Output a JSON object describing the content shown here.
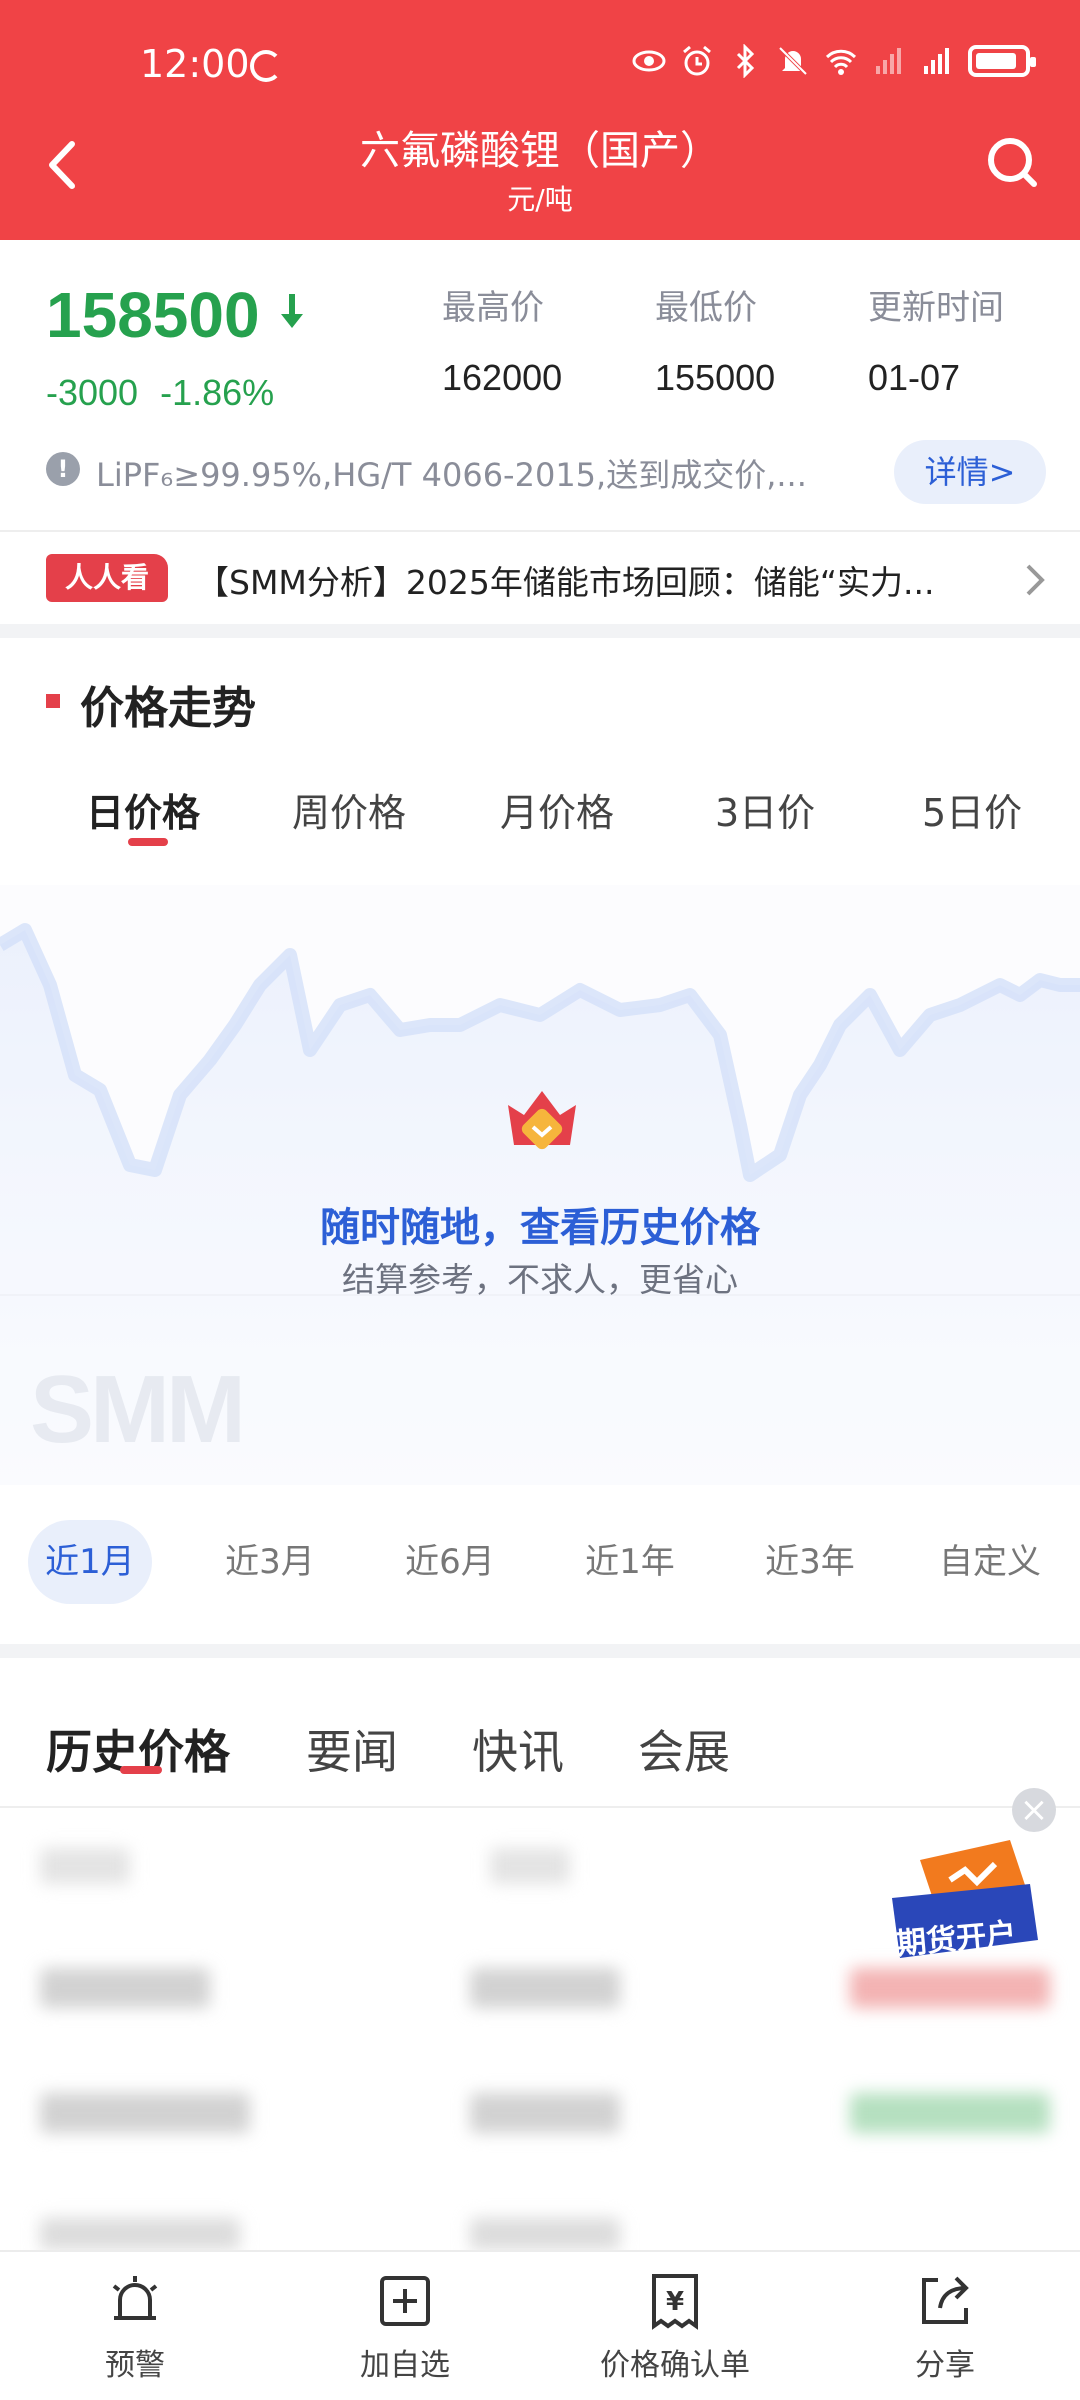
{
  "status_bar": {
    "time": "12:00",
    "icons": [
      "eye-icon",
      "alarm-icon",
      "bluetooth-icon",
      "mute-icon",
      "wifi-icon",
      "signal-icon",
      "signal-5g-icon",
      "battery-icon"
    ]
  },
  "header": {
    "title": "六氟磷酸锂（国产）",
    "subtitle": "元/吨",
    "back_icon": "back-arrow-icon",
    "search_icon": "search-icon"
  },
  "price": {
    "current": "158500",
    "direction": "down",
    "change_abs": "-3000",
    "change_pct": "-1.86%",
    "high_label": "最高价",
    "high_value": "162000",
    "low_label": "最低价",
    "low_value": "155000",
    "update_label": "更新时间",
    "update_value": "01-07",
    "description": "LiPF₆≥99.95%,HG/T 4066-2015,送到成交价,...",
    "detail_label": "详情>",
    "colors": {
      "down": "#26a14e",
      "accent": "#f04346",
      "link": "#2c5fd6"
    }
  },
  "news": {
    "tag": "人人看",
    "headline": "【SMM分析】2025年储能市场回顾：储能“实力..."
  },
  "trend": {
    "section_title": "价格走势",
    "period_tabs": [
      "日价格",
      "周价格",
      "月价格",
      "3日价",
      "5日价"
    ],
    "active_period": 0,
    "promo_title": "随时随地，查看历史价格",
    "promo_subtitle": "结算参考，不求人，更省心",
    "watermark": "SMM",
    "range_tabs": [
      "近1月",
      "近3月",
      "近6月",
      "近1年",
      "近3年",
      "自定义"
    ],
    "active_range": 0
  },
  "content_tabs": {
    "tabs": [
      "历史价格",
      "要闻",
      "快讯",
      "会展"
    ],
    "active": 0
  },
  "float_ad": {
    "label": "期货开户"
  },
  "bottom_nav": {
    "items": [
      {
        "label": "预警",
        "icon": "alarm-bell-icon"
      },
      {
        "label": "加自选",
        "icon": "add-watchlist-icon"
      },
      {
        "label": "价格确认单",
        "icon": "price-confirm-icon"
      },
      {
        "label": "分享",
        "icon": "share-icon"
      }
    ]
  }
}
